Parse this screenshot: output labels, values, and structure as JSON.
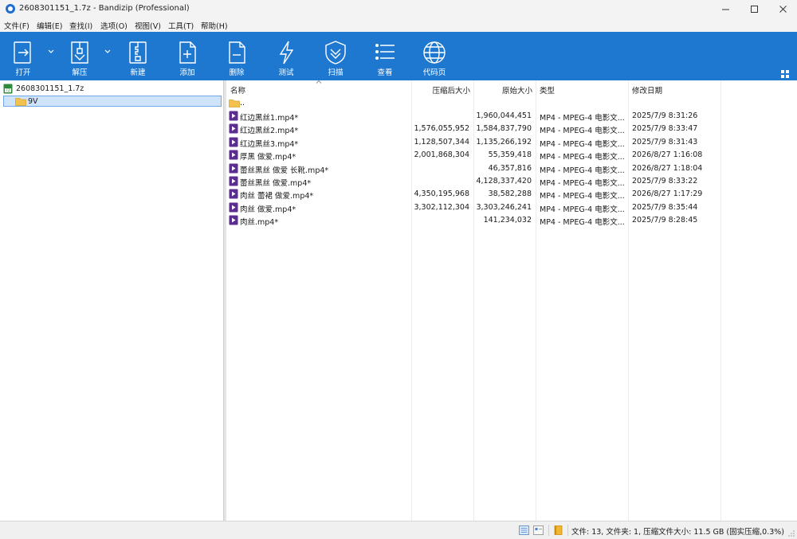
{
  "window": {
    "title": "2608301151_1.7z - Bandizip (Professional)"
  },
  "menu": [
    "文件(F)",
    "编辑(E)",
    "查找(I)",
    "选项(O)",
    "视图(V)",
    "工具(T)",
    "帮助(H)"
  ],
  "toolbar": {
    "open_label": "打开",
    "extract_label": "解压",
    "new_label": "新建",
    "add_label": "添加",
    "delete_label": "删除",
    "test_label": "测试",
    "scan_label": "扫描",
    "view_label": "查看",
    "codepage_label": "代码页",
    "accent_color": "#1f78d0"
  },
  "tree": {
    "root_label": "2608301151_1.7z",
    "child_label": "9V"
  },
  "columns": {
    "name": "名称",
    "packed": "压缩后大小",
    "original": "原始大小",
    "type": "类型",
    "modified": "修改日期"
  },
  "parent_entry": "..",
  "files": [
    {
      "name": "红边黑丝1.mp4*",
      "packed": "",
      "original": "1,960,044,451",
      "type": "MP4 - MPEG-4 电影文...",
      "modified": "2025/7/9 8:31:26"
    },
    {
      "name": "红边黑丝2.mp4*",
      "packed": "1,576,055,952",
      "original": "1,584,837,790",
      "type": "MP4 - MPEG-4 电影文...",
      "modified": "2025/7/9 8:33:47"
    },
    {
      "name": "红边黑丝3.mp4*",
      "packed": "1,128,507,344",
      "original": "1,135,266,192",
      "type": "MP4 - MPEG-4 电影文...",
      "modified": "2025/7/9 8:31:43"
    },
    {
      "name": "厚黑 做爱.mp4*",
      "packed": "2,001,868,304",
      "original": "55,359,418",
      "type": "MP4 - MPEG-4 电影文...",
      "modified": "2026/8/27 1:16:08"
    },
    {
      "name": "蕾丝黑丝 做爱 长靴.mp4*",
      "packed": "",
      "original": "46,357,816",
      "type": "MP4 - MPEG-4 电影文...",
      "modified": "2026/8/27 1:18:04"
    },
    {
      "name": "蕾丝黑丝 做爱.mp4*",
      "packed": "",
      "original": "4,128,337,420",
      "type": "MP4 - MPEG-4 电影文...",
      "modified": "2025/7/9 8:33:22"
    },
    {
      "name": "肉丝 蕾裙 做爱.mp4*",
      "packed": "4,350,195,968",
      "original": "38,582,288",
      "type": "MP4 - MPEG-4 电影文...",
      "modified": "2026/8/27 1:17:29"
    },
    {
      "name": "肉丝 做爱.mp4*",
      "packed": "3,302,112,304",
      "original": "3,303,246,241",
      "type": "MP4 - MPEG-4 电影文...",
      "modified": "2025/7/9 8:35:44"
    },
    {
      "name": "肉丝.mp4*",
      "packed": "",
      "original": "141,234,032",
      "type": "MP4 - MPEG-4 电影文...",
      "modified": "2025/7/9 8:28:45"
    }
  ],
  "status": {
    "text": "文件: 13, 文件夹: 1, 压缩文件大小: 11.5 GB (固实压缩,0.3%)"
  }
}
